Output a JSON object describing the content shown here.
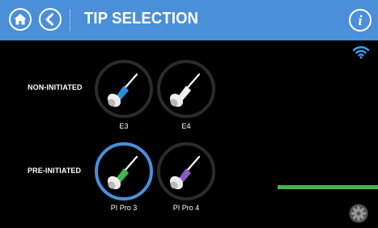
{
  "header": {
    "title": "TIP SELECTION",
    "home_icon": "home-icon",
    "back_icon": "chevron-left-icon",
    "info_label": "i"
  },
  "status": {
    "wifi_icon": "wifi-icon"
  },
  "rows": [
    {
      "label": "NON-INITIATED",
      "tips": [
        {
          "label": "E3",
          "color": "#2f8fd9",
          "selected": false
        },
        {
          "label": "E4",
          "color": "#ffffff",
          "selected": false
        }
      ]
    },
    {
      "label": "PRE-INITIATED",
      "tips": [
        {
          "label": "PI Pro 3",
          "color": "#3fb54a",
          "selected": true
        },
        {
          "label": "PI Pro 4",
          "color": "#8a5bbf",
          "selected": false
        }
      ]
    }
  ],
  "footer": {
    "settings_icon": "gear-icon"
  },
  "colors": {
    "header": "#4a8fd8",
    "selected_ring": "#4a8fd8",
    "status_bar": "#43b649"
  }
}
